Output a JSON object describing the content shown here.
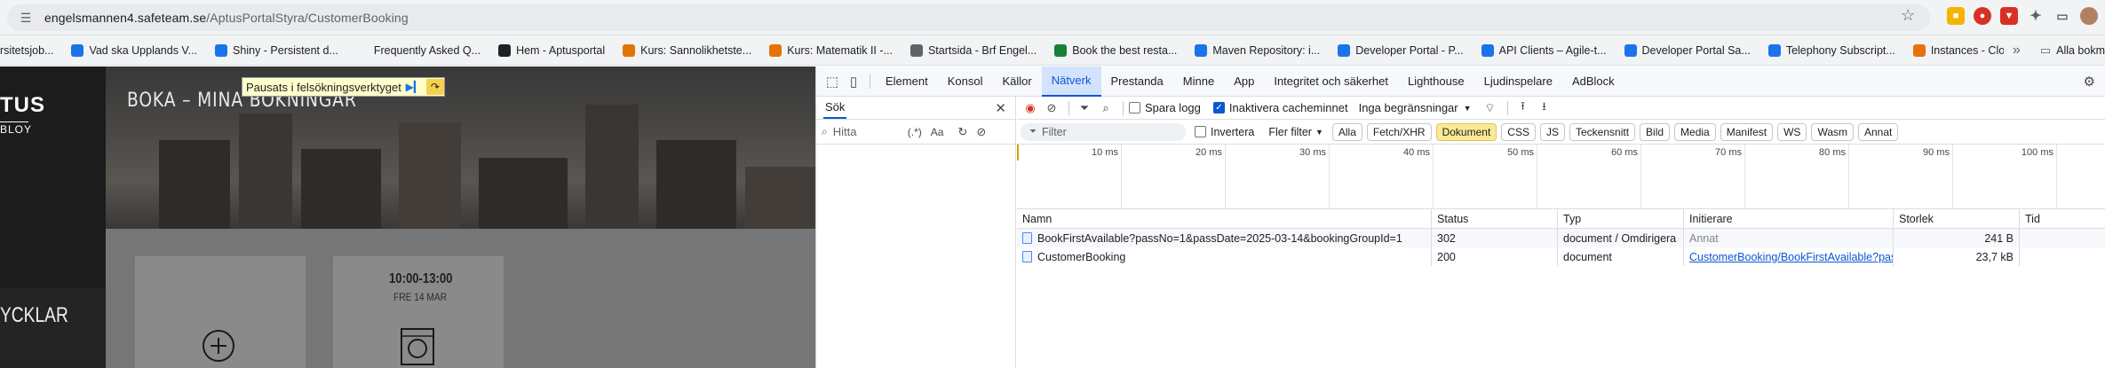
{
  "address_bar": {
    "host": "engelsmannen4.safeteam.se",
    "path": "/AptusPortalStyra/CustomerBooking"
  },
  "bookmarks": [
    {
      "label": "rsitetsjob...",
      "color": "#5f6368"
    },
    {
      "label": "Vad ska Upplands V...",
      "color": "#1a73e8"
    },
    {
      "label": "Shiny - Persistent d...",
      "color": "#1a73e8"
    },
    {
      "label": "Frequently Asked Q...",
      "color": "#f1f3f4"
    },
    {
      "label": "Hem - Aptusportal",
      "color": "#202124"
    },
    {
      "label": "Kurs: Sannolikhetste...",
      "color": "#e37400"
    },
    {
      "label": "Kurs: Matematik II -...",
      "color": "#e37400"
    },
    {
      "label": "Startsida - Brf Engel...",
      "color": "#5f6368"
    },
    {
      "label": "Book the best resta...",
      "color": "#188038"
    },
    {
      "label": "Maven Repository: i...",
      "color": "#1a73e8"
    },
    {
      "label": "Developer Portal - P...",
      "color": "#1a73e8"
    },
    {
      "label": "API Clients – Agile-t...",
      "color": "#1a73e8"
    },
    {
      "label": "Developer Portal Sa...",
      "color": "#1a73e8"
    },
    {
      "label": "Telephony Subscript...",
      "color": "#1a73e8"
    },
    {
      "label": "Instances - CloudA...",
      "color": "#e8710a"
    }
  ],
  "bookmarks_more": "»",
  "bookmarks_all": "Alla bokm",
  "site": {
    "logo_top": "TUS",
    "logo_bottom": "BLOY",
    "hero_title": "BOKA – MINA BOKNINGAR",
    "side_label": "YCKLAR",
    "slot_time": "10:00-13:00",
    "slot_date": "FRE 14 MAR"
  },
  "debug_tooltip": "Pausats i felsökningsverktyget",
  "devtools": {
    "tabs": [
      "Element",
      "Konsol",
      "Källor",
      "Nätverk",
      "Prestanda",
      "Minne",
      "App",
      "Integritet och säkerhet",
      "Lighthouse",
      "Ljudinspelare",
      "AdBlock"
    ],
    "active_tab": "Nätverk",
    "search_title": "Sök",
    "search_placeholder": "Hitta",
    "search_regex": "(.*)",
    "search_case": "Aa",
    "toolbar": {
      "preserve_log": "Spara logg",
      "disable_cache": "Inaktivera cacheminnet",
      "throttling": "Inga begränsningar"
    },
    "filter": {
      "placeholder": "Filter",
      "invert": "Invertera",
      "more_filters": "Fler filter",
      "types": [
        "Alla",
        "Fetch/XHR",
        "Dokument",
        "CSS",
        "JS",
        "Teckensnitt",
        "Bild",
        "Media",
        "Manifest",
        "WS",
        "Wasm",
        "Annat"
      ],
      "active_type": "Dokument"
    },
    "timeline_ticks": [
      "10 ms",
      "20 ms",
      "30 ms",
      "40 ms",
      "50 ms",
      "60 ms",
      "70 ms",
      "80 ms",
      "90 ms",
      "100 ms"
    ],
    "columns": [
      "Namn",
      "Status",
      "Typ",
      "Initierare",
      "Storlek",
      "Tid"
    ],
    "rows": [
      {
        "name": "BookFirstAvailable?passNo=1&passDate=2025-03-14&bookingGroupId=1",
        "status": "302",
        "type": "document / Omdirigera",
        "initiator": "Annat",
        "size": "241 B",
        "time": ""
      },
      {
        "name": "CustomerBooking",
        "status": "200",
        "type": "document",
        "initiator": "CustomerBooking/BookFirstAvailable?passN",
        "size": "23,7 kB",
        "time": ""
      }
    ]
  }
}
